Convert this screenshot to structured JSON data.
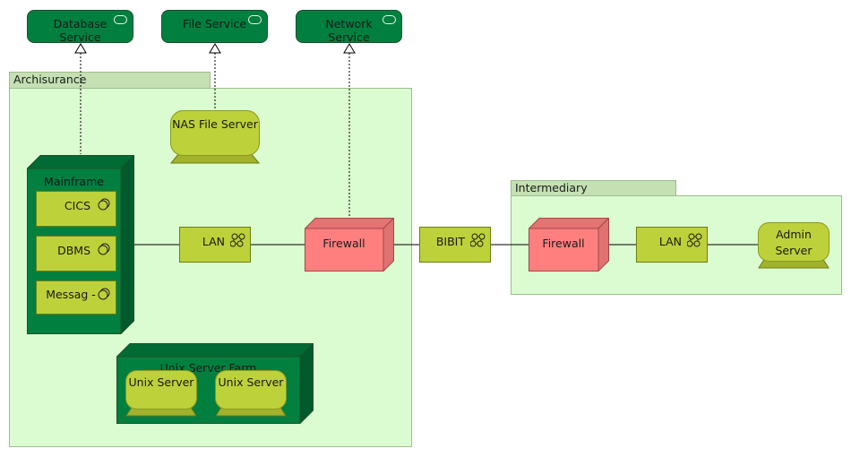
{
  "colors": {
    "service_fill": "#007f3f",
    "node_fill": "#007f3f",
    "syssw_fill": "#bdd13b",
    "firewall_fill": "#ff7f7f",
    "group_fill": "#dbfbd0",
    "group_tab_fill": "#c5e0b3"
  },
  "services": [
    {
      "label": "Database Service",
      "icon": "service-icon"
    },
    {
      "label": "File Service",
      "icon": "service-icon"
    },
    {
      "label": "Network Service",
      "icon": "service-icon"
    }
  ],
  "groups": {
    "archisurance": {
      "label": "Archisurance"
    },
    "intermediary": {
      "label": "Intermediary"
    }
  },
  "nas": {
    "label": "NAS File Server",
    "icon": "device-icon"
  },
  "mainframe": {
    "label": "Mainframe",
    "software": [
      {
        "label": "CICS",
        "icon": "system-software-icon"
      },
      {
        "label": "DBMS",
        "icon": "system-software-icon"
      },
      {
        "label": "Messag -",
        "icon": "system-software-icon"
      }
    ]
  },
  "unix_farm": {
    "label": "Unix Server Farm",
    "servers": [
      {
        "label": "Unix Server",
        "icon": "device-icon"
      },
      {
        "label": "Unix Server",
        "icon": "device-icon"
      }
    ]
  },
  "networks": {
    "lan1": {
      "label": "LAN",
      "icon": "network-icon"
    },
    "bibit": {
      "label": "BIBIT",
      "icon": "network-icon"
    },
    "lan2": {
      "label": "LAN",
      "icon": "network-icon"
    }
  },
  "firewalls": {
    "fw1": {
      "label": "Firewall"
    },
    "fw2": {
      "label": "Firewall"
    }
  },
  "admin": {
    "label": "Admin Server",
    "icon": "device-icon"
  }
}
